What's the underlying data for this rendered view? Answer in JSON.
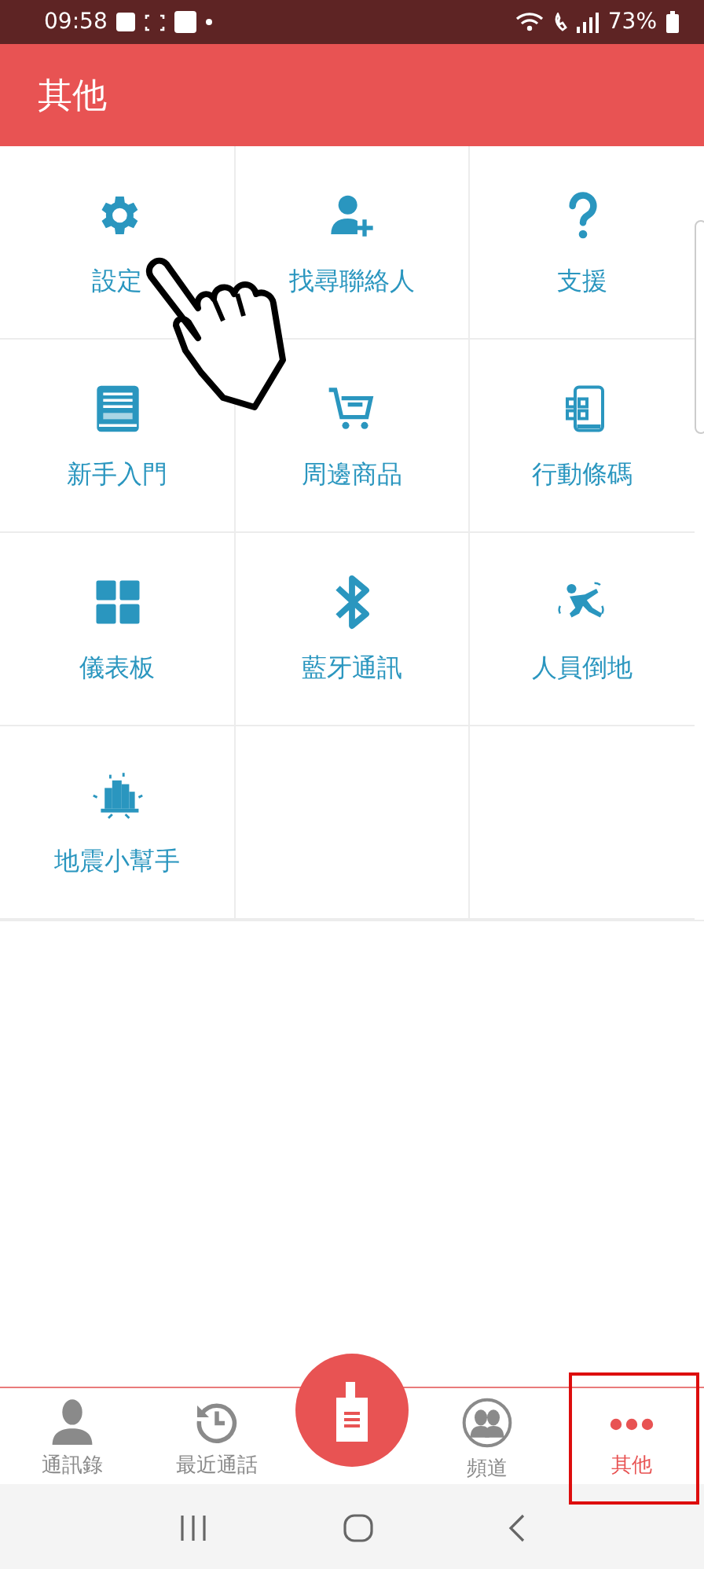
{
  "status_bar": {
    "time": "09:58",
    "battery": "73%"
  },
  "header": {
    "title": "其他"
  },
  "grid": [
    {
      "kind": "gear",
      "label": "設定"
    },
    {
      "kind": "person-add",
      "label": "找尋聯絡人"
    },
    {
      "kind": "question",
      "label": "支援"
    },
    {
      "kind": "guide",
      "label": "新手入門"
    },
    {
      "kind": "cart",
      "label": "周邊商品"
    },
    {
      "kind": "qr-phone",
      "label": "行動條碼"
    },
    {
      "kind": "dashboard",
      "label": "儀表板"
    },
    {
      "kind": "bluetooth",
      "label": "藍牙通訊"
    },
    {
      "kind": "fall",
      "label": "人員倒地"
    },
    {
      "kind": "quake",
      "label": "地震小幫手"
    }
  ],
  "bottom_nav": [
    {
      "kind": "person",
      "label": "通訊錄",
      "selected": false
    },
    {
      "kind": "history",
      "label": "最近通話",
      "selected": false
    },
    {
      "kind": "talk",
      "selected": false
    },
    {
      "kind": "group",
      "label": "頻道",
      "selected": false
    },
    {
      "kind": "more",
      "label": "其他",
      "selected": true
    }
  ]
}
